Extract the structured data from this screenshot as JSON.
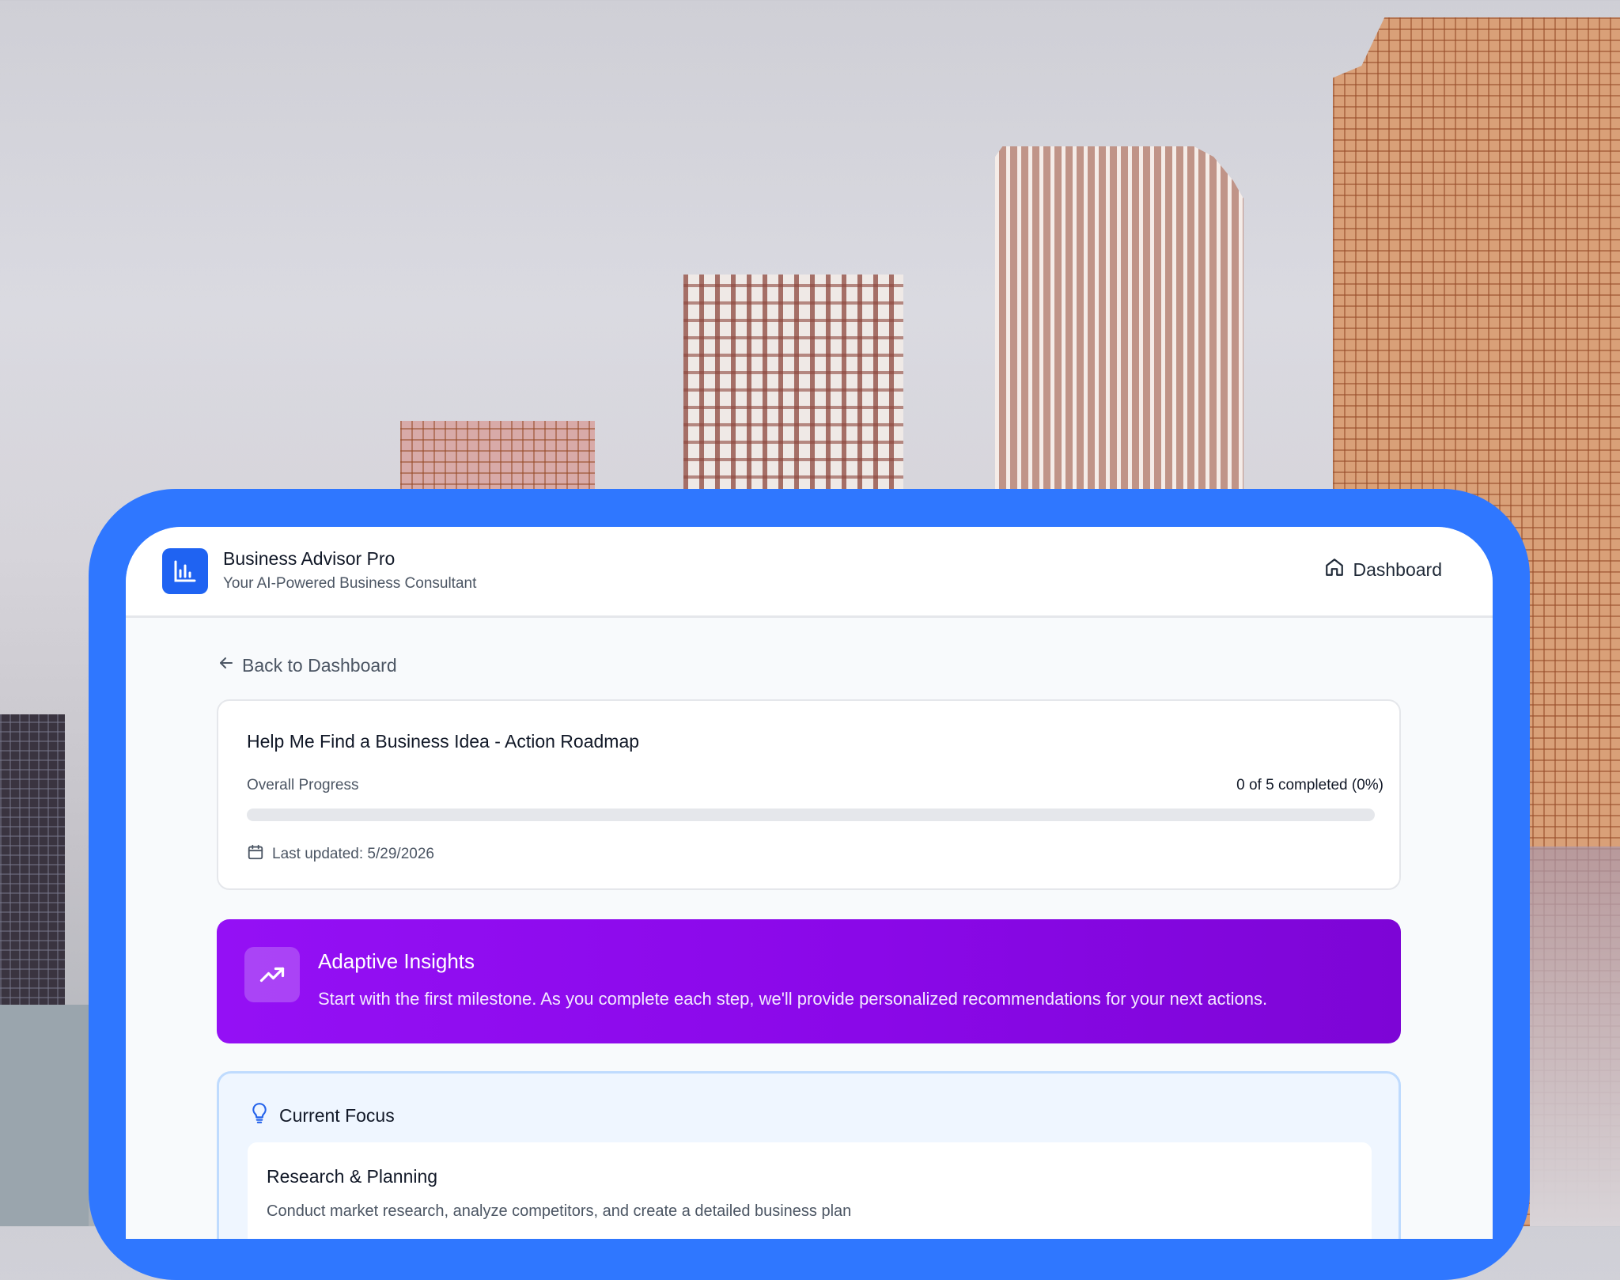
{
  "app": {
    "name": "Business Advisor Pro",
    "tagline": "Your AI-Powered Business Consultant",
    "logo_icon": "bar-chart-icon",
    "accent": "#1f63f2"
  },
  "nav": {
    "dashboard_label": "Dashboard",
    "dashboard_icon": "home-icon"
  },
  "back": {
    "label": "Back to Dashboard",
    "icon": "arrow-left-icon"
  },
  "roadmap": {
    "title": "Help Me Find a Business Idea - Action Roadmap",
    "progress_label": "Overall Progress",
    "progress_text": "0 of 5 completed (0%)",
    "progress_percent": 0,
    "last_updated": "Last updated: 5/29/2026",
    "calendar_icon": "calendar-icon"
  },
  "insights": {
    "title": "Adaptive Insights",
    "text": "Start with the first milestone. As you complete each step, we'll provide personalized recommendations for your next actions.",
    "icon": "trending-up-icon",
    "color": "#8a08e8"
  },
  "focus": {
    "heading": "Current Focus",
    "icon": "lightbulb-icon",
    "item": {
      "title": "Research & Planning",
      "description": "Conduct market research, analyze competitors, and create a detailed business plan"
    }
  }
}
